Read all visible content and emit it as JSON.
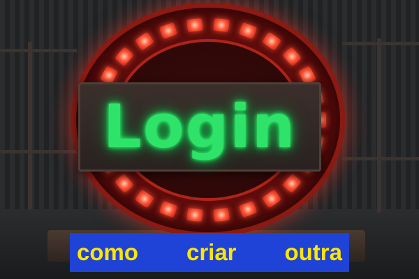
{
  "sign": {
    "text": "Login",
    "glow_color": "#2fe36a"
  },
  "caption": {
    "words": [
      "como",
      "criar",
      "outra"
    ],
    "background": "#1f43d6",
    "text_color": "#ffe600"
  }
}
